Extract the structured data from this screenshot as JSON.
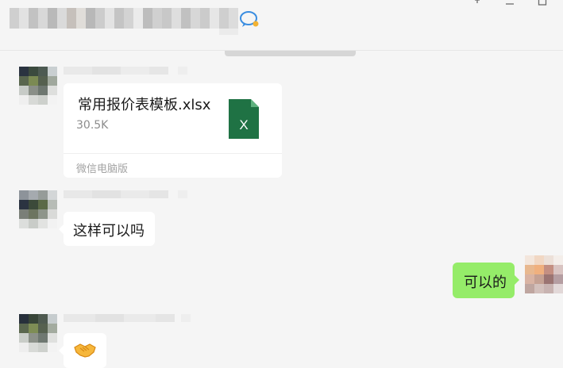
{
  "header": {
    "chat_name_blurred": true,
    "window_controls": [
      "pin-icon",
      "minimize-icon",
      "maximize-icon"
    ]
  },
  "messages": [
    {
      "side": "left",
      "type": "file",
      "file": {
        "name": "常用报价表模板.xlsx",
        "size": "30.5K",
        "source": "微信电脑版",
        "icon": "excel-file-icon",
        "icon_label": "X",
        "icon_color": "#1f7244"
      }
    },
    {
      "side": "left",
      "type": "text",
      "text": "这样可以吗"
    },
    {
      "side": "right",
      "type": "text",
      "text": "可以的"
    },
    {
      "side": "left",
      "type": "emoji",
      "emoji": "handshake-emoji"
    }
  ],
  "colors": {
    "background": "#f5f5f5",
    "incoming_bubble": "#ffffff",
    "outgoing_bubble": "#95ec69"
  }
}
